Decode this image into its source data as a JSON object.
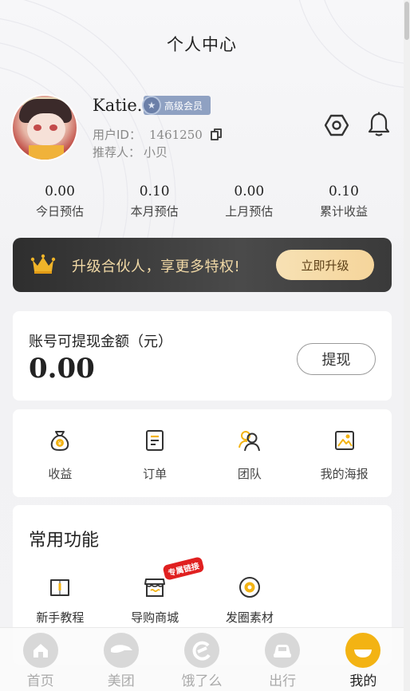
{
  "page": {
    "title": "个人中心"
  },
  "profile": {
    "name": "Katie.",
    "badge": "高级会员",
    "uid_label": "用户ID：",
    "uid": "1461250",
    "referrer_label": "推荐人：",
    "referrer": "小贝"
  },
  "stats": [
    {
      "value": "0.00",
      "label": "今日预估"
    },
    {
      "value": "0.10",
      "label": "本月预估"
    },
    {
      "value": "0.00",
      "label": "上月预估"
    },
    {
      "value": "0.10",
      "label": "累计收益"
    }
  ],
  "upgrade": {
    "text": "升级合伙人，享更多特权!",
    "button": "立即升级"
  },
  "withdraw": {
    "label": "账号可提现金额（元）",
    "amount": "0.00",
    "button": "提现"
  },
  "menu": [
    {
      "label": "收益",
      "icon": "money-bag-icon"
    },
    {
      "label": "订单",
      "icon": "order-list-icon"
    },
    {
      "label": "团队",
      "icon": "team-icon"
    },
    {
      "label": "我的海报",
      "icon": "poster-icon"
    }
  ],
  "functions": {
    "title": "常用功能",
    "items": [
      {
        "label": "新手教程",
        "icon": "tutorial-book-icon"
      },
      {
        "label": "导购商城",
        "icon": "shop-icon",
        "tag": "专属链接"
      },
      {
        "label": "发圈素材",
        "icon": "material-icon"
      }
    ]
  },
  "tabbar": [
    {
      "label": "首页",
      "icon": "home-icon",
      "active": false
    },
    {
      "label": "美团",
      "icon": "meituan-icon",
      "active": false
    },
    {
      "label": "饿了么",
      "icon": "eleme-icon",
      "active": false
    },
    {
      "label": "出行",
      "icon": "car-icon",
      "active": false
    },
    {
      "label": "我的",
      "icon": "mine-icon",
      "active": true
    }
  ],
  "colors": {
    "accent": "#f3b313",
    "banner_bg": "#3a3a3a",
    "banner_text": "#f1d9a6",
    "badge_bg": "#8fa1c2",
    "tag_red": "#e02020"
  }
}
